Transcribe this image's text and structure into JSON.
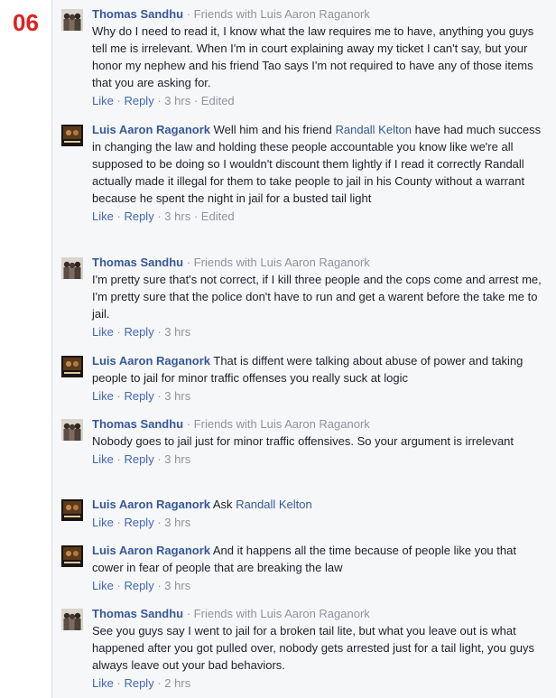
{
  "page_number": "06",
  "labels": {
    "separator": "·",
    "like": "Like",
    "reply": "Reply",
    "edited": "Edited"
  },
  "comments": [
    {
      "author": "Thomas Sandhu",
      "context": "Friends with Luis Aaron Raganork",
      "avatar": "thomas-avatar",
      "segments": [
        {
          "text": "Why do I need to read it, I know what the law requires me to have, anything you guys tell me is irrelevant. When I'm in court explaining away my ticket I can't say, but your honor my nephew and his friend Tao says I'm not required to have any of those items that you are asking for."
        }
      ],
      "time": "3 hrs",
      "edited": true
    },
    {
      "author": "Luis Aaron Raganork",
      "context": "",
      "avatar": "luis-avatar",
      "segments": [
        {
          "text": "Well him and his friend "
        },
        {
          "text": "Randall Kelton",
          "mention": true
        },
        {
          "text": " have had much success in changing the law and holding these people accountable you know like we're all supposed to be doing so I wouldn't discount them lightly if I read it correctly Randall actually made it illegal for them to take people to jail in his County without a warrant because he spent the night in jail for a busted tail light"
        }
      ],
      "time": "3 hrs",
      "edited": true
    },
    {
      "author": "Thomas Sandhu",
      "context": "Friends with Luis Aaron Raganork",
      "avatar": "thomas-avatar",
      "segments": [
        {
          "text": "I'm pretty sure that's not correct, if I kill three people and the cops come and arrest me, I'm pretty sure that the police don't have to run and get a warent before the take me to jail."
        }
      ],
      "time": "3 hrs",
      "edited": false
    },
    {
      "author": "Luis Aaron Raganork",
      "context": "",
      "avatar": "luis-avatar",
      "segments": [
        {
          "text": "That is diffent were talking about abuse of power and taking people to jail for minor traffic offenses you really suck at logic"
        }
      ],
      "time": "3 hrs",
      "edited": false
    },
    {
      "author": "Thomas Sandhu",
      "context": "Friends with Luis Aaron Raganork",
      "avatar": "thomas-avatar",
      "segments": [
        {
          "text": "Nobody goes to jail just for minor traffic offensives. So your argument is irrelevant"
        }
      ],
      "time": "3 hrs",
      "edited": false
    },
    {
      "author": "Luis Aaron Raganork",
      "context": "",
      "avatar": "luis-avatar",
      "segments": [
        {
          "text": "Ask "
        },
        {
          "text": "Randall Kelton",
          "mention": true
        }
      ],
      "time": "3 hrs",
      "edited": false
    },
    {
      "author": "Luis Aaron Raganork",
      "context": "",
      "avatar": "luis-avatar",
      "segments": [
        {
          "text": "And it happens all the time because of people like you that cower in fear of people that are breaking the law"
        }
      ],
      "time": "3 hrs",
      "edited": false
    },
    {
      "author": "Thomas Sandhu",
      "context": "Friends with Luis Aaron Raganork",
      "avatar": "thomas-avatar",
      "segments": [
        {
          "text": "See you guys say I went to jail for a broken tail lite, but what you leave out is what happened after you got pulled over, nobody gets arrested just for a tail light, you guys always leave out your bad behaviors."
        }
      ],
      "time": "2 hrs",
      "edited": false
    }
  ]
}
